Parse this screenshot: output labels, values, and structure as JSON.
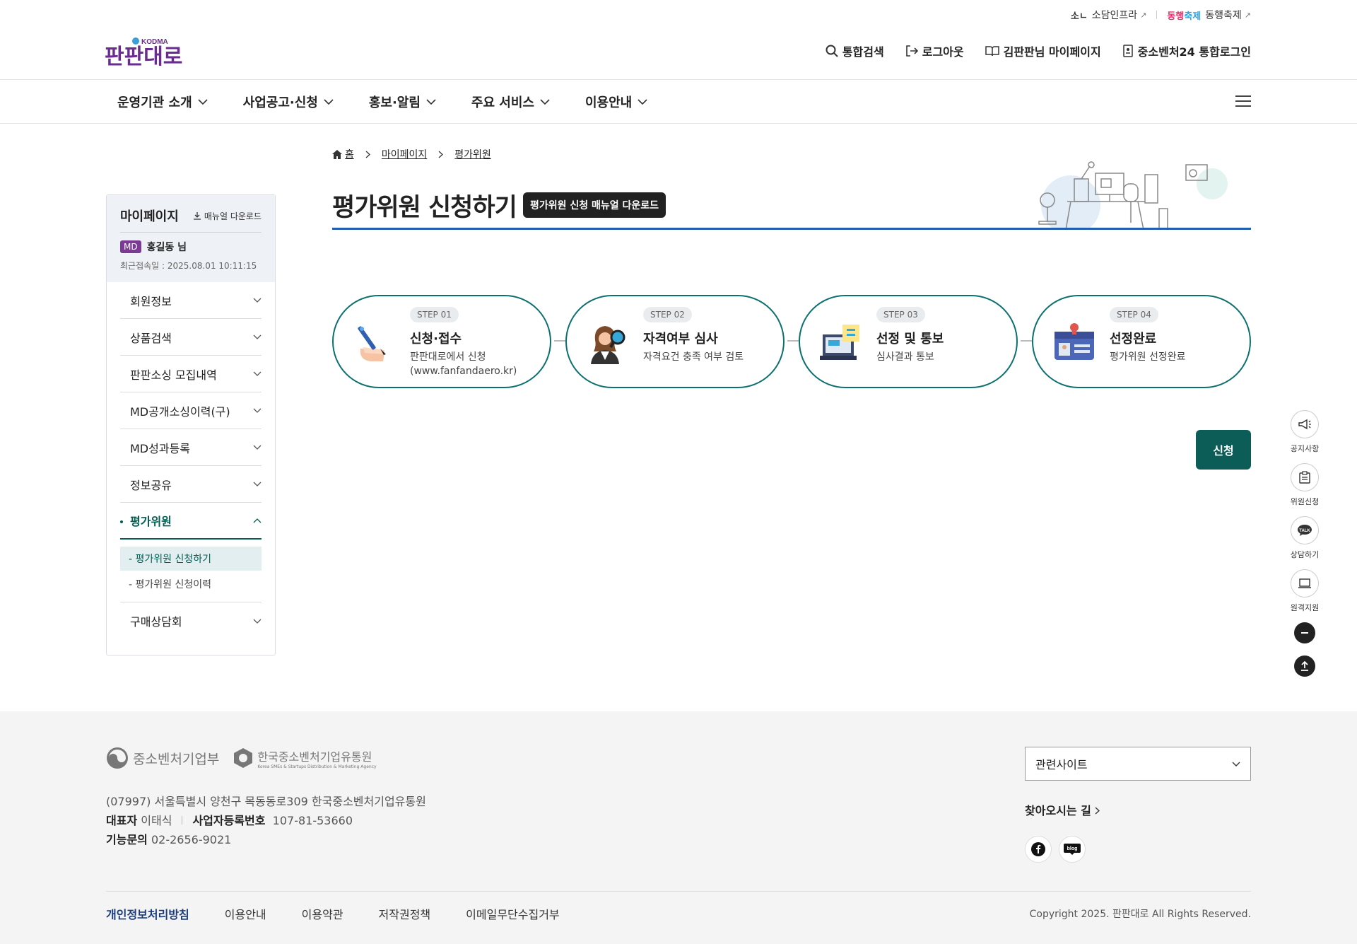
{
  "util": {
    "item1": "소담인프라",
    "item2": "동행축제"
  },
  "header": {
    "logo": "판판대로",
    "logo_badge": "KODMA",
    "search": "통합검색",
    "logout": "로그아웃",
    "mypage": "김판판님 마이페이지",
    "login24": "중소벤처24 통합로그인"
  },
  "gnb": [
    "운영기관 소개",
    "사업공고·신청",
    "홍보·알림",
    "주요 서비스",
    "이용안내"
  ],
  "side": {
    "title": "마이페이지",
    "download": "매뉴얼 다운로드",
    "badge": "MD",
    "user": "홍길동 님",
    "last": "최근접속일 : 2025.08.01 10:11:15",
    "menu": [
      "회원정보",
      "상품검색",
      "판판소싱 모집내역",
      "MD공개소싱이력(구)",
      "MD성과등록",
      "정보공유",
      "평가위원",
      "구매상담회"
    ],
    "sub": [
      "- 평가위원 신청하기",
      "- 평가위원 신청이력"
    ]
  },
  "breadcrumb": {
    "home": "홈",
    "l1": "마이페이지",
    "l2": "평가위원"
  },
  "page": {
    "title": "평가위원 신청하기",
    "manual": "평가위원 신청 매뉴얼 다운로드",
    "apply": "신청"
  },
  "steps": [
    {
      "no": "STEP 01",
      "name": "신청·접수",
      "desc1": "판판대로에서 신청",
      "desc2": "(www.fanfandaero.kr)",
      "icon": "hand-pen-icon"
    },
    {
      "no": "STEP 02",
      "name": "자격여부 심사",
      "desc1": "자격요건 충족 여부 검토",
      "desc2": "",
      "icon": "magnifier-person-icon"
    },
    {
      "no": "STEP 03",
      "name": "선정 및 통보",
      "desc1": "심사결과 통보",
      "desc2": "",
      "icon": "laptop-notice-icon"
    },
    {
      "no": "STEP 04",
      "name": "선정완료",
      "desc1": "평가위원 선정완료",
      "desc2": "",
      "icon": "id-card-icon"
    }
  ],
  "quick": [
    "공지사항",
    "위원신청",
    "상담하기",
    "원격지원"
  ],
  "quick_talk": "TALK",
  "footer": {
    "ministry": "중소벤처기업부",
    "agency": "한국중소벤처기업유통원",
    "agency_en": "Korea SMEs & Startups Distribution & Marketing Agency",
    "address": "(07997) 서울특별시 양천구 목동동로309 한국중소벤처기업유통원",
    "rep_label": "대표자",
    "rep": "이태식",
    "biz_label": "사업자등록번호",
    "biz": "107-81-53660",
    "tel_label": "기능문의",
    "tel": "02-2656-9021",
    "related": "관련사이트",
    "way": "찾아오시는 길",
    "links": [
      "개인정보처리방침",
      "이용안내",
      "이용약관",
      "저작권정책",
      "이메일무단수집거부"
    ],
    "copyright": "Copyright 2025. 판판대로 All Rights Reserved.",
    "blog": "blog"
  },
  "colors": {
    "accent": "#0c5d58",
    "title_line": "#1f5fae",
    "brand": "#6b2c91"
  }
}
